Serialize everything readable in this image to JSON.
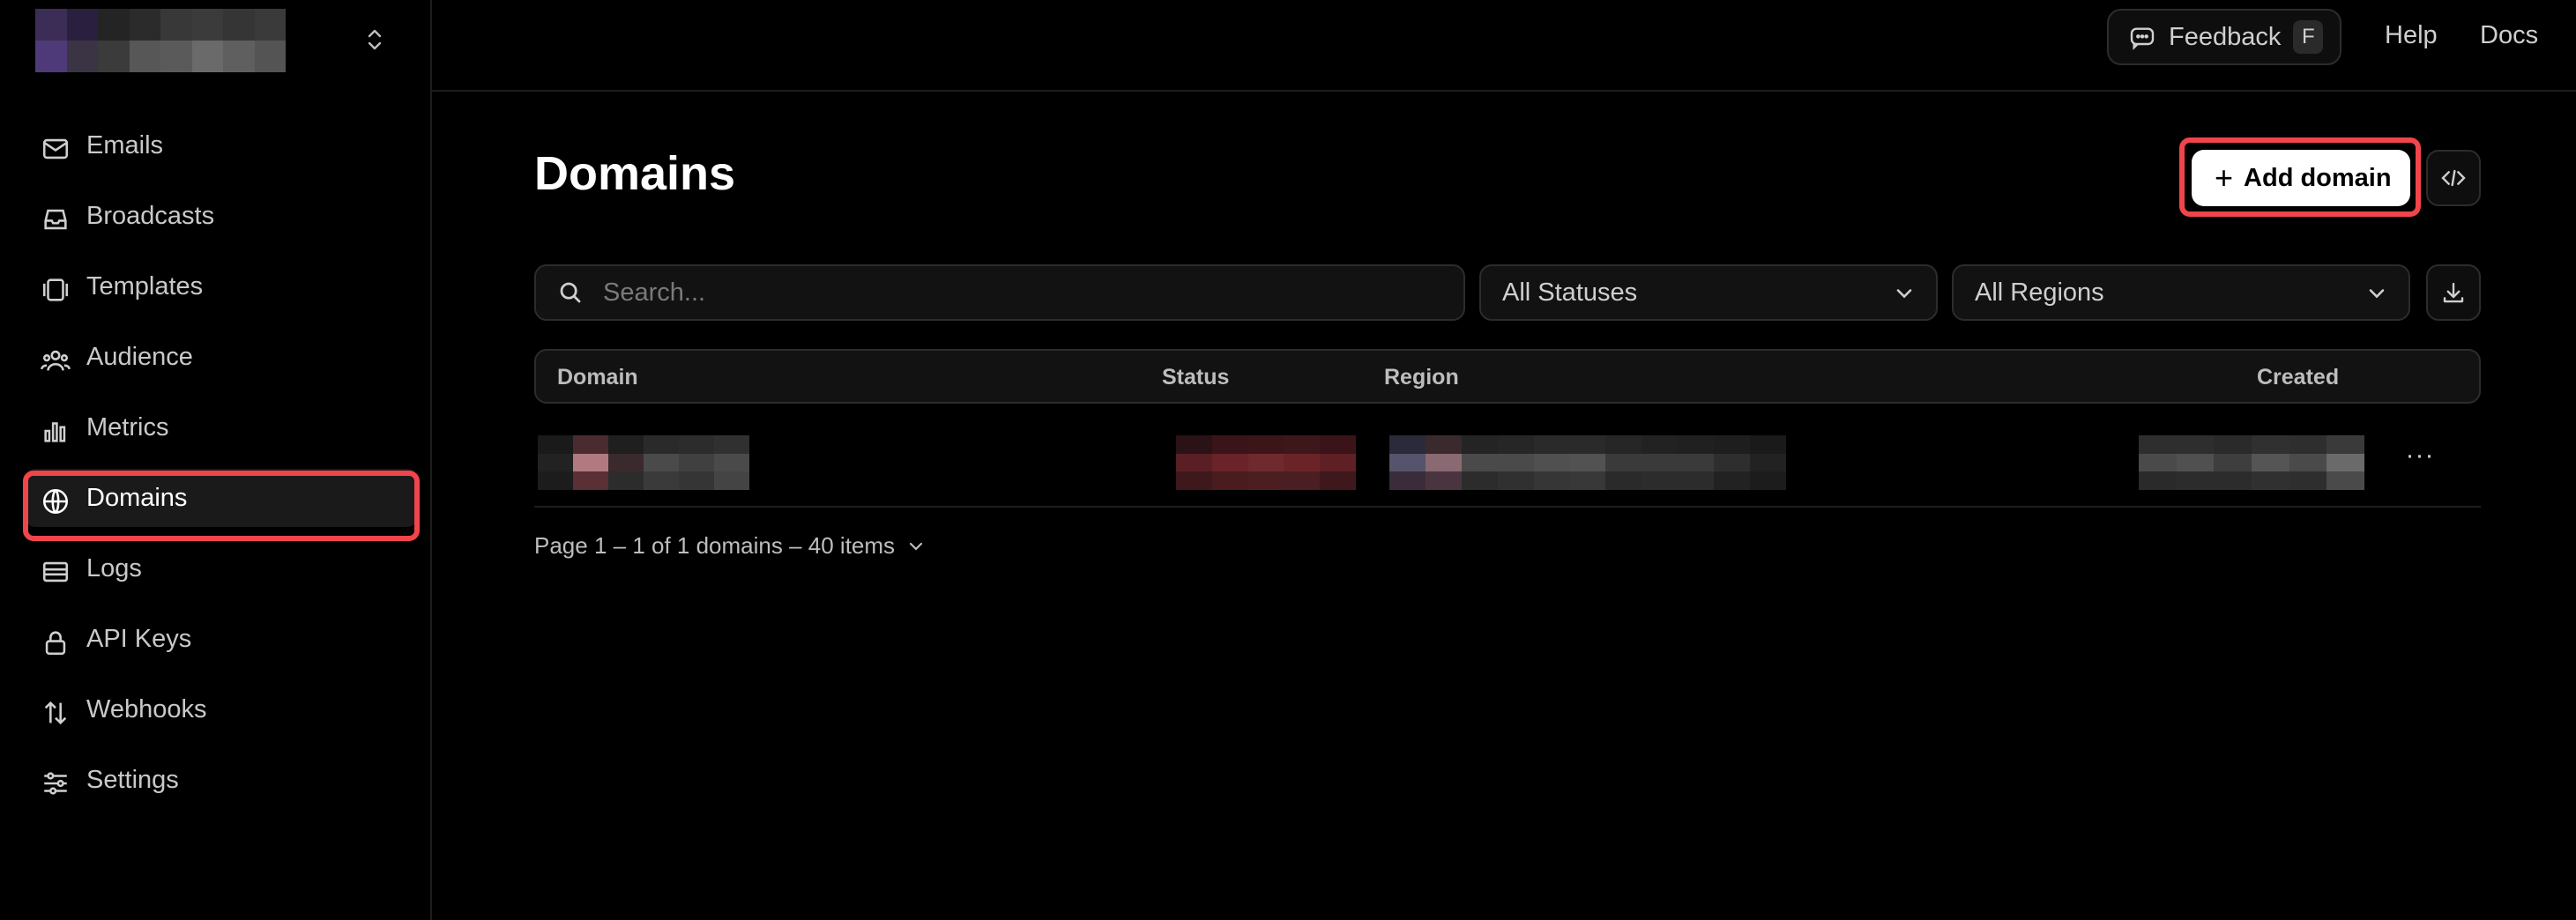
{
  "sidebar": {
    "workspace_logo_colors": [
      "#3c2d57",
      "#2a1f3f",
      "#242424",
      "#2b2b2b",
      "#383838",
      "#3b3b3b",
      "#353535",
      "#3a3a3a",
      "#4f3a79",
      "#3a3445",
      "#3b3b3b",
      "#575757",
      "#5a5a5a",
      "#6a6a6a",
      "#5f5f5f",
      "#545454"
    ],
    "items": [
      {
        "label": "Emails",
        "icon": "mail-icon"
      },
      {
        "label": "Broadcasts",
        "icon": "inbox-icon"
      },
      {
        "label": "Templates",
        "icon": "templates-icon"
      },
      {
        "label": "Audience",
        "icon": "users-icon"
      },
      {
        "label": "Metrics",
        "icon": "bar-chart-icon"
      },
      {
        "label": "Domains",
        "icon": "globe-icon",
        "active": true
      },
      {
        "label": "Logs",
        "icon": "logs-icon"
      },
      {
        "label": "API Keys",
        "icon": "lock-icon"
      },
      {
        "label": "Webhooks",
        "icon": "webhooks-icon"
      },
      {
        "label": "Settings",
        "icon": "settings-sliders-icon"
      }
    ]
  },
  "header": {
    "feedback_label": "Feedback",
    "feedback_shortcut": "F",
    "help_label": "Help",
    "docs_label": "Docs"
  },
  "main": {
    "title": "Domains",
    "add_button_label": "Add domain",
    "search_placeholder": "Search...",
    "status_filter": "All Statuses",
    "region_filter": "All Regions",
    "columns": {
      "domain": "Domain",
      "status": "Status",
      "region": "Region",
      "created": "Created"
    },
    "pagination_text": "Page 1 – 1 of 1 domains – 40 items",
    "row_menu_label": "···"
  },
  "colors": {
    "accent_highlight": "#f0454b",
    "background": "#000000"
  }
}
